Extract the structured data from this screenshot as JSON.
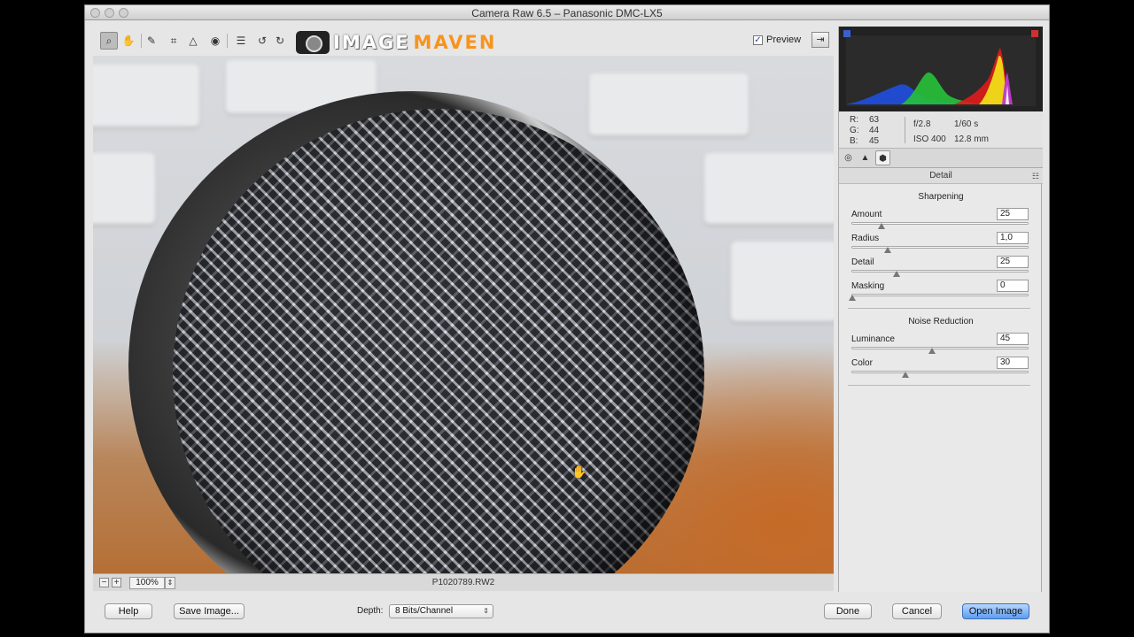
{
  "window": {
    "title": "Camera Raw 6.5  –  Panasonic DMC-LX5"
  },
  "toolbar": {
    "tools": [
      {
        "name": "zoom-tool",
        "icon": "magnifier-icon",
        "glyph": "⌕"
      },
      {
        "name": "hand-tool",
        "icon": "hand-icon",
        "glyph": "✋"
      },
      {
        "name": "white-balance-tool",
        "icon": "eyedropper-icon",
        "glyph": "✎"
      },
      {
        "name": "crop-tool",
        "icon": "crop-icon",
        "glyph": "⌗"
      },
      {
        "name": "straighten-tool",
        "icon": "straighten-icon",
        "glyph": "△"
      },
      {
        "name": "red-eye-tool",
        "icon": "red-eye-icon",
        "glyph": "◉"
      },
      {
        "name": "preferences-tool",
        "icon": "list-icon",
        "glyph": "☰"
      },
      {
        "name": "rotate-left-tool",
        "icon": "rotate-ccw-icon",
        "glyph": "↺"
      },
      {
        "name": "rotate-right-tool",
        "icon": "rotate-cw-icon",
        "glyph": "↻"
      }
    ],
    "logo": {
      "part1": "IMAGE",
      "part2": "MAVEN"
    },
    "preview_label": "Preview",
    "preview_checked": "✓",
    "fullscreen_glyph": "⇥"
  },
  "status": {
    "zoom_out": "−",
    "zoom_in": "+",
    "zoom_value": "100%",
    "zoom_arrow": "⇕",
    "filename": "P1020789.RW2"
  },
  "readout": {
    "r_label": "R:",
    "r_value": "63",
    "g_label": "G:",
    "g_value": "44",
    "b_label": "B:",
    "b_value": "45",
    "aperture": "f/2.8",
    "shutter": "1/60 s",
    "iso": "ISO 400",
    "focal": "12.8 mm"
  },
  "panel": {
    "tabs": [
      {
        "name": "tab-basic",
        "icon": "aperture-icon",
        "glyph": "◎"
      },
      {
        "name": "tab-tone-curve",
        "icon": "mountain-icon",
        "glyph": "▲"
      },
      {
        "name": "tab-detail",
        "icon": "detail-icon",
        "glyph": "⬢"
      }
    ],
    "header": "Detail",
    "menu_glyph": "☷",
    "sharpening": {
      "title": "Sharpening",
      "amount": {
        "label": "Amount",
        "value": "25",
        "min": 0,
        "max": 150,
        "num": 25
      },
      "radius": {
        "label": "Radius",
        "value": "1,0",
        "min": 0.5,
        "max": 3.0,
        "num": 1.0
      },
      "detail": {
        "label": "Detail",
        "value": "25",
        "min": 0,
        "max": 100,
        "num": 25
      },
      "masking": {
        "label": "Masking",
        "value": "0",
        "min": 0,
        "max": 100,
        "num": 0
      }
    },
    "noise": {
      "title": "Noise Reduction",
      "luminance": {
        "label": "Luminance",
        "value": "45",
        "min": 0,
        "max": 100,
        "num": 45
      },
      "color": {
        "label": "Color",
        "value": "30",
        "min": 0,
        "max": 100,
        "num": 30
      }
    }
  },
  "bottom": {
    "help": "Help",
    "save": "Save Image...",
    "depth_label": "Depth:",
    "depth_value": "8 Bits/Channel",
    "depth_arrow": "⇕",
    "done": "Done",
    "cancel": "Cancel",
    "open": "Open Image"
  },
  "colors": {
    "accent": "#5d9cf0",
    "logo_orange": "#f7941d"
  }
}
